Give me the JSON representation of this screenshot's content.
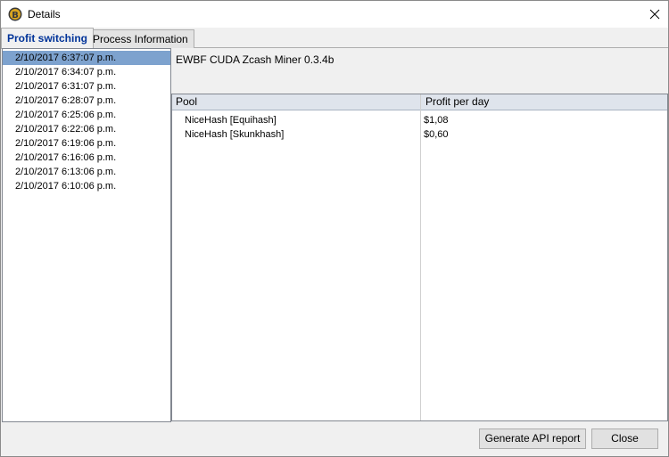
{
  "window": {
    "title": "Details",
    "icon": "bitcoin-coin-icon",
    "close_icon": "close-icon"
  },
  "tabs": [
    {
      "label": "Profit switching",
      "active": true
    },
    {
      "label": "Process Information",
      "active": false
    }
  ],
  "timestamps": [
    "2/10/2017 6:37:07 p.m.",
    "2/10/2017 6:34:07 p.m.",
    "2/10/2017 6:31:07 p.m.",
    "2/10/2017 6:28:07 p.m.",
    "2/10/2017 6:25:06 p.m.",
    "2/10/2017 6:22:06 p.m.",
    "2/10/2017 6:19:06 p.m.",
    "2/10/2017 6:16:06 p.m.",
    "2/10/2017 6:13:06 p.m.",
    "2/10/2017 6:10:06 p.m."
  ],
  "selected_timestamp_index": 0,
  "miner_name": "EWBF CUDA Zcash Miner 0.3.4b",
  "pool_table": {
    "columns": [
      "Pool",
      "Profit per day"
    ],
    "rows": [
      {
        "pool": "NiceHash [Equihash]",
        "profit": "$1,08"
      },
      {
        "pool": "NiceHash [Skunkhash]",
        "profit": "$0,60"
      }
    ]
  },
  "buttons": {
    "api_report": "Generate API report",
    "close": "Close"
  },
  "colors": {
    "selection": "#7da2ce",
    "active_tab_text": "#003399",
    "coin": "#d9a520"
  }
}
